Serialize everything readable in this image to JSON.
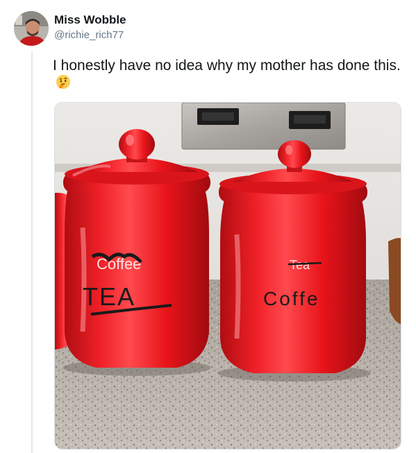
{
  "tweet": {
    "display_name": "Miss Wobble",
    "handle": "@richie_rich77",
    "text": "I honestly have no idea why my mother has done this.",
    "emoji_icon": "thinking-face-icon"
  },
  "photo": {
    "left_jar": {
      "crossed_label": "Coffee",
      "label": "TEA"
    },
    "right_jar": {
      "crossed_label": "Tea",
      "label": "Coffe"
    }
  },
  "colors": {
    "jar_red": "#e8141a",
    "handle_gray": "#657786",
    "text_dark": "#14171a"
  }
}
